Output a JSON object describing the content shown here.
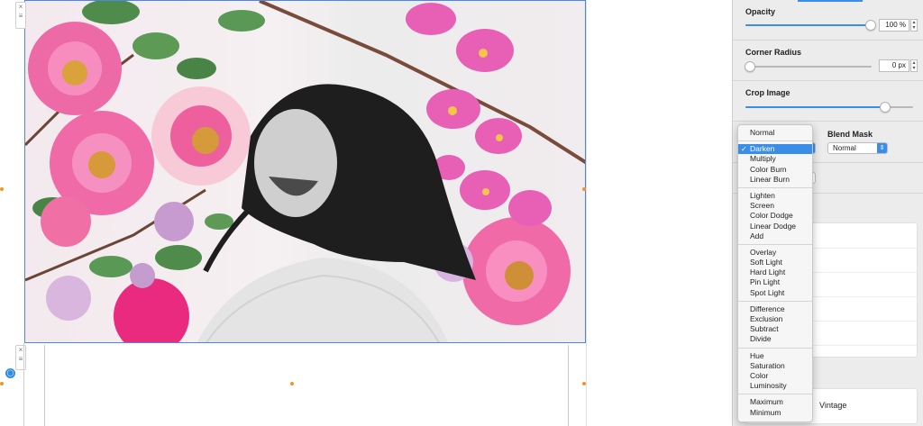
{
  "properties": {
    "opacity": {
      "label": "Opacity",
      "value": "100 %",
      "level": 1.0
    },
    "corner_radius": {
      "label": "Corner Radius",
      "value": "0 px",
      "level": 0.0
    },
    "crop_image": {
      "label": "Crop Image",
      "level": 0.97
    },
    "blend_mask": {
      "label": "Blend Mask",
      "value": "Normal"
    },
    "preset_label": "Vintage"
  },
  "blend_menu": {
    "selected": "Darken",
    "groups": [
      [
        "Normal"
      ],
      [
        "Darken",
        "Multiply",
        "Color Burn",
        "Linear Burn"
      ],
      [
        "Lighten",
        "Screen",
        "Color Dodge",
        "Linear Dodge",
        "Add"
      ],
      [
        "Overlay",
        "Soft Light",
        "Hard Light",
        "Pin Light",
        "Spot Light"
      ],
      [
        "Difference",
        "Exclusion",
        "Subtract",
        "Divide"
      ],
      [
        "Hue",
        "Saturation",
        "Color",
        "Luminosity"
      ],
      [
        "Maximum",
        "Minimum"
      ]
    ]
  },
  "colors": {
    "accent": "#3b8ee8",
    "selection_border": "#4a87e8",
    "handle": "#f0932b"
  }
}
